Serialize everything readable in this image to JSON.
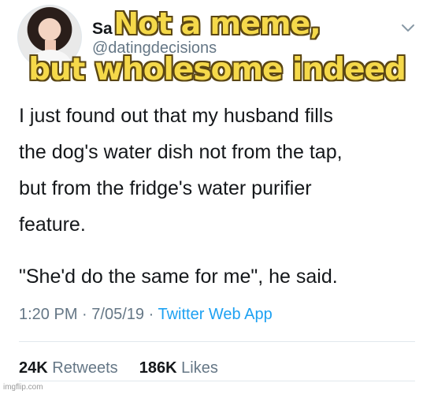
{
  "tweet": {
    "display_name": "Sa",
    "handle": "@datingdecisions",
    "lines": [
      "I just found out that my husband fills",
      "the dog's water dish not from the tap,",
      "but from the fridge's water purifier",
      "feature."
    ],
    "quote": "\"She'd do the same for me\", he said.",
    "time": "1:20 PM",
    "date": "7/05/19",
    "separator": "·",
    "source": "Twitter Web App",
    "retweets_count": "24K",
    "retweets_label": "Retweets",
    "likes_count": "186K",
    "likes_label": "Likes",
    "chevron_icon": "chevron-down-icon",
    "avatar_icon": "avatar"
  },
  "caption": {
    "line1": "Not a meme,",
    "line2": "but wholesome indeed",
    "fill_color": "#f5d94a",
    "outline_color": "#5a4614"
  },
  "watermark": "imgflip.com",
  "colors": {
    "text": "#14171a",
    "muted": "#657786",
    "link": "#1da1f2",
    "divider": "#e1e8ed"
  }
}
